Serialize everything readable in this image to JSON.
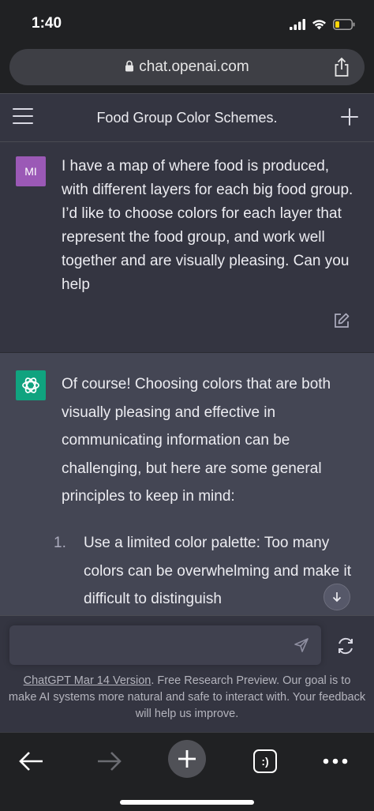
{
  "status_bar": {
    "time": "1:40",
    "icons": [
      "signal-icon",
      "wifi-icon",
      "battery-icon"
    ],
    "battery_color": "#ffd60a"
  },
  "browser": {
    "url": "chat.openai.com",
    "icons": [
      "lock-icon",
      "share-icon"
    ]
  },
  "header": {
    "title": "Food Group Color Schemes.",
    "icons": [
      "menu-icon",
      "plus-icon"
    ]
  },
  "conversation": {
    "user_message": {
      "avatar_initials": "MI",
      "avatar_color": "#9b59b6",
      "text": "I have a map of where food is produced, with different layers for each big food group. I’d like to choose colors for each layer that represent the food group, and work well together and are visually pleasing. Can you help"
    },
    "assistant_message": {
      "avatar_color": "#10a37f",
      "intro": "Of course! Choosing colors that are both visually pleasing and effective in communicating information can be challenging, but here are some general principles to keep in mind:",
      "list": [
        {
          "number": "1.",
          "text": "Use a limited color palette: Too many colors can be overwhelming and make it difficult to distinguish"
        }
      ]
    }
  },
  "composer": {
    "placeholder": "",
    "footer_link": "ChatGPT Mar 14 Version",
    "footer_text": ". Free Research Preview. Our goal is to make AI systems more natural and safe to interact with. Your feedback will help us improve."
  },
  "toolbar": {
    "tabs_label": ":)",
    "icons": [
      "back-arrow-icon",
      "forward-arrow-icon",
      "plus-icon",
      "tabs-icon",
      "more-icon"
    ]
  },
  "colors": {
    "background": "#202123",
    "chat_bg": "#343541",
    "assistant_bg": "#444654"
  }
}
